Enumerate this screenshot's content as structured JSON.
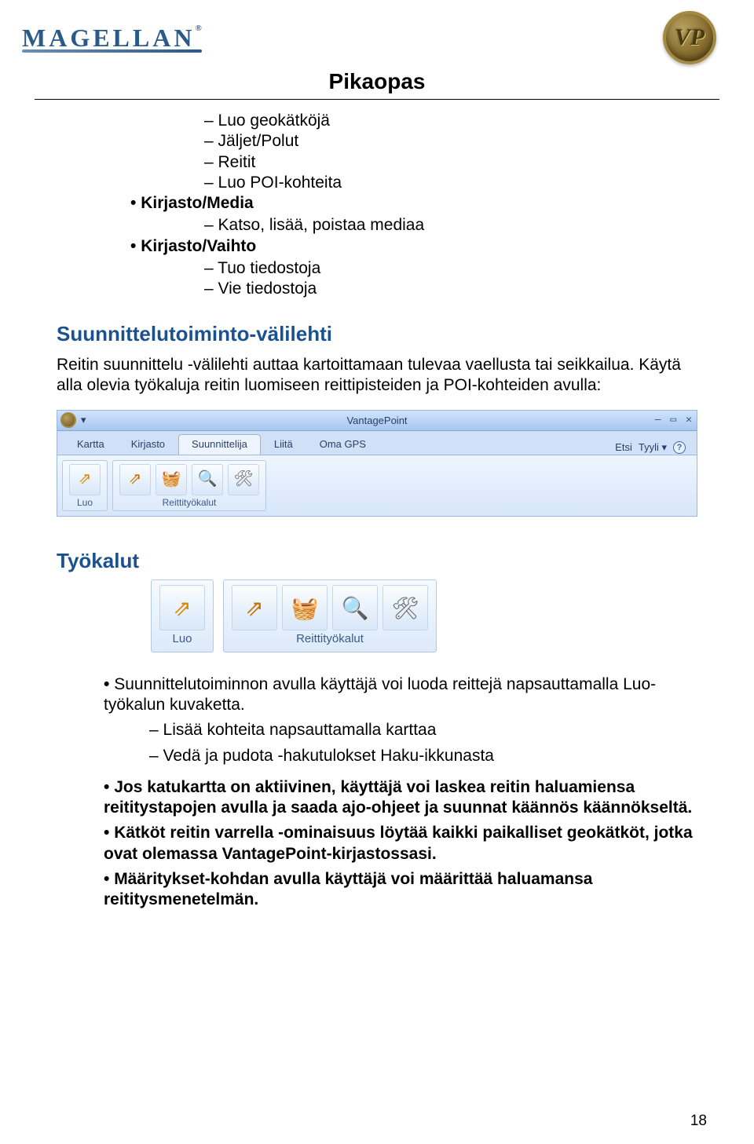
{
  "header": {
    "brand": "MAGELLAN",
    "brand_reg": "®",
    "vp_badge_text": "VP"
  },
  "doc": {
    "title": "Pikaopas",
    "page_number": "18"
  },
  "list_top_dash": [
    "Luo geokätköjä",
    "Jäljet/Polut",
    "Reitit",
    "Luo POI-kohteita"
  ],
  "list_top_bullets": [
    {
      "label": "Kirjasto/Media",
      "sub": [
        "Katso, lisää, poistaa mediaa"
      ]
    },
    {
      "label": "Kirjasto/Vaihto",
      "sub": [
        "Tuo tiedostoja",
        "Vie tiedostoja"
      ]
    }
  ],
  "section1": {
    "heading": "Suunnittelutoiminto-välilehti",
    "para": "Reitin suunnittelu -välilehti auttaa kartoittamaan tulevaa vaellusta tai seikkailua. Käytä alla olevia työkaluja reitin luomiseen reittipisteiden ja POI-kohteiden avulla:"
  },
  "ribbon": {
    "title": "VantagePoint",
    "qat_dropdown": "▾",
    "win_min": "—",
    "win_max": "▭",
    "win_close": "✕",
    "tabs_left": [
      "Kartta",
      "Kirjasto",
      "Suunnittelija",
      "Liitä",
      "Oma GPS"
    ],
    "tab_active_index": 2,
    "tabs_right": {
      "etsi": "Etsi",
      "tyyli": "Tyyli",
      "tyyli_arrow": "▾"
    },
    "groups": [
      {
        "label": "Luo",
        "icons": [
          "route"
        ]
      },
      {
        "label": "Reittityökalut",
        "icons": [
          "route2",
          "chest",
          "zoom",
          "tools"
        ]
      }
    ],
    "icon_glyphs": {
      "route": "⇗",
      "route2": "⇗",
      "chest": "🧺",
      "zoom": "🔍",
      "tools": "🛠"
    }
  },
  "section2": {
    "heading": "Työkalut",
    "groups": [
      {
        "label": "Luo",
        "icons": [
          "route"
        ]
      },
      {
        "label": "Reittityökalut",
        "icons": [
          "route2",
          "chest",
          "zoom",
          "tools"
        ]
      }
    ]
  },
  "lower": {
    "b1": "Suunnittelutoiminnon avulla käyttäjä voi luoda reittejä napsauttamalla Luo-työkalun kuvaketta.",
    "b1_sub": [
      "Lisää kohteita napsauttamalla karttaa",
      "Vedä ja pudota -hakutulokset Haku-ikkunasta"
    ],
    "bold_items": [
      "Jos katukartta on aktiivinen, käyttäjä voi laskea reitin haluamiensa reititystapojen avulla ja saada ajo-ohjeet ja suunnat käännös käännökseltä.",
      "Kätköt reitin varrella -ominaisuus löytää kaikki paikalliset geokätköt, jotka ovat olemassa VantagePoint-kirjastossasi.",
      "Määritykset-kohdan avulla käyttäjä voi määrittää haluamansa reititysmenetelmän."
    ]
  }
}
